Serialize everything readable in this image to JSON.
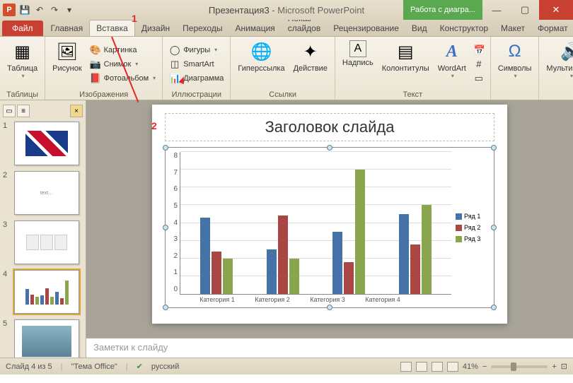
{
  "title": {
    "doc": "Презентация3",
    "app": "Microsoft PowerPoint",
    "chart_tools": "Работа с диагра..."
  },
  "tabs": {
    "file": "Файл",
    "items": [
      "Главная",
      "Вставка",
      "Дизайн",
      "Переходы",
      "Анимация",
      "Показ слайдов",
      "Рецензирование",
      "Вид",
      "Конструктор",
      "Макет",
      "Формат"
    ],
    "active_index": 1
  },
  "ribbon": {
    "groups": {
      "tables": {
        "label": "Таблицы",
        "table": "Таблица"
      },
      "images": {
        "label": "Изображения",
        "picture": "Рисунок",
        "clip": "Картинка",
        "screenshot": "Снимок",
        "album": "Фотоальбом"
      },
      "illus": {
        "label": "Иллюстрации",
        "shapes": "Фигуры",
        "smartart": "SmartArt",
        "chart": "Диаграмма"
      },
      "links": {
        "label": "Ссылки",
        "hyperlink": "Гиперссылка",
        "action": "Действие"
      },
      "text": {
        "label": "Текст",
        "textbox": "Надпись",
        "hf": "Колонтитулы",
        "wordart": "WordArt"
      },
      "symbols": {
        "label": "",
        "symbols": "Символы"
      },
      "media": {
        "label": "",
        "media": "Мультимедиа"
      }
    }
  },
  "slide": {
    "title": "Заголовок слайда"
  },
  "chart_data": {
    "type": "bar",
    "categories": [
      "Категория 1",
      "Категория 2",
      "Категория 3",
      "Категория 4"
    ],
    "series": [
      {
        "name": "Ряд 1",
        "color": "#4573a7",
        "values": [
          4.3,
          2.5,
          3.5,
          4.5
        ]
      },
      {
        "name": "Ряд 2",
        "color": "#aa4644",
        "values": [
          2.4,
          4.4,
          1.8,
          2.8
        ]
      },
      {
        "name": "Ряд 3",
        "color": "#89a54e",
        "values": [
          2.0,
          2.0,
          7.0,
          5.0
        ]
      }
    ],
    "ylim": [
      0,
      8
    ],
    "yticks": [
      0,
      1,
      2,
      3,
      4,
      5,
      6,
      7,
      8
    ]
  },
  "notes": {
    "placeholder": "Заметки к слайду"
  },
  "status": {
    "slide_of": "Слайд 4 из 5",
    "theme": "\"Тема Office\"",
    "lang": "русский",
    "zoom": "41%"
  },
  "annotations": {
    "n1": "1",
    "n2": "2"
  },
  "thumbs": [
    1,
    2,
    3,
    4,
    5
  ]
}
